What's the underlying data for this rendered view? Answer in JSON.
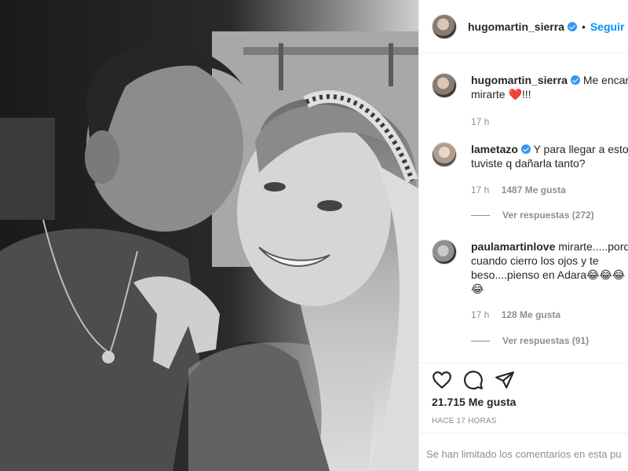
{
  "post": {
    "username": "hugomartin_sierra",
    "separator": "•",
    "follow_label": "Seguir"
  },
  "comments": [
    {
      "username": "hugomartin_sierra",
      "text_line1": "Me encant",
      "text_line2": "mirarte",
      "emoji": "❤️",
      "text_tail": "!!!",
      "time": "17 h"
    },
    {
      "username": "lametazo",
      "text_line1": "Y para llegar a esto",
      "text_line2": "tuviste q dañarla tanto?",
      "time": "17 h",
      "likes": "1487 Me gusta",
      "replies": "Ver respuestas (272)"
    },
    {
      "username": "paulamartinlove",
      "text_line1": "mirarte.....porqu",
      "text_line2": "cuando cierro los ojos y te",
      "text_line3": "beso....pienso en Adara😂😂😂",
      "text_line4": "😂",
      "time": "17 h",
      "likes": "128 Me gusta",
      "replies": "Ver respuestas (91)"
    }
  ],
  "actions": {
    "like_icon": "heart-outline-icon",
    "comment_icon": "comment-bubble-icon",
    "share_icon": "paper-plane-icon"
  },
  "likes_count": "21.715 Me gusta",
  "posted_ago": "HACE 17 HORAS",
  "footer_notice": "Se han limitado los comentarios en esta pu",
  "colors": {
    "link_blue": "#0095f6",
    "verified_blue": "#3897f0",
    "muted_gray": "#8e8e8e",
    "border": "#efefef"
  }
}
